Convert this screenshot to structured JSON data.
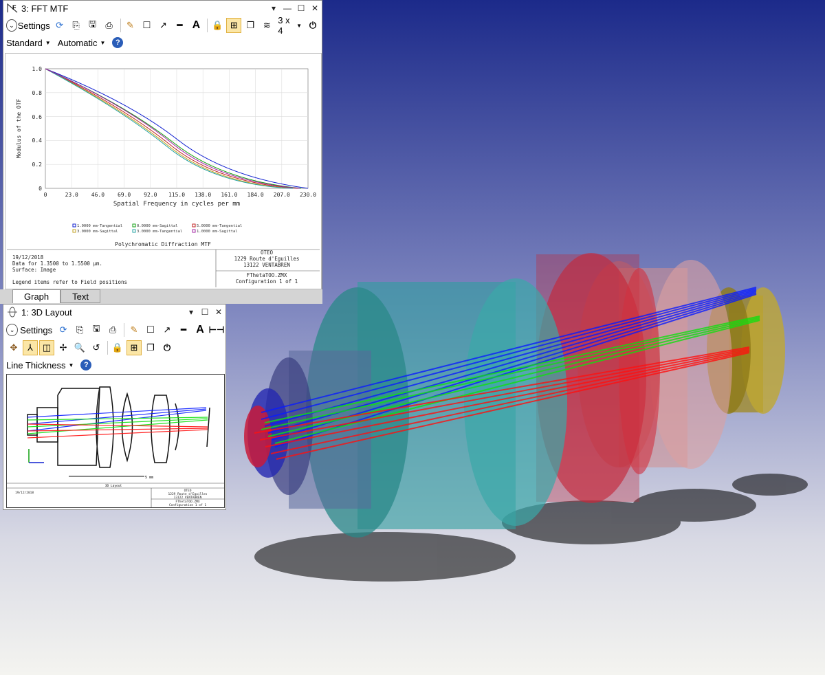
{
  "mtf_window": {
    "title": "3: FFT MTF",
    "settings_label": "Settings",
    "grid_label": "3 x 4",
    "dropdown1": "Standard",
    "dropdown2": "Automatic",
    "tabs": [
      "Graph",
      "Text"
    ],
    "plot": {
      "ylabel": "Modulus of the OTF",
      "xlabel": "Spatial Frequency in cycles per mm",
      "xticks": [
        "0",
        "23.0",
        "46.0",
        "69.0",
        "92.0",
        "115.0",
        "138.0",
        "161.0",
        "184.0",
        "207.0",
        "230.0"
      ],
      "yticks": [
        "0",
        "0.2",
        "0.4",
        "0.6",
        "0.8",
        "1.0"
      ],
      "legend": [
        "1.0000 mm-Tangential",
        "0.0000 mm-Sagittal",
        "5.0000 mm-Tangential",
        "3.0000 mm-Sagittal",
        "3.0000 mm-Tangential",
        "1.0000 mm-Sagittal"
      ],
      "caption": "Polychromatic Diffraction MTF",
      "info_left": [
        "19/12/2018",
        "Data for 1.3500 to 1.5500 µm.",
        "Surface: Image",
        "",
        "Legend items refer to Field positions"
      ],
      "info_right_top": [
        "OTEO",
        "1229 Route d'Eguilles",
        "13122 VENTABREN"
      ],
      "info_right_bottom": [
        "FThetaTOO.ZMX",
        "Configuration 1 of 1"
      ]
    }
  },
  "layout_window": {
    "title": "1: 3D Layout",
    "settings_label": "Settings",
    "dropdown": "Line Thickness",
    "scale_label": "3D Layout",
    "scale_value": "5 mm",
    "info_left": "19/12/2018",
    "info_right_top": [
      "OTEO",
      "1229 Route d'Eguilles",
      "13122 VENTABREN"
    ],
    "info_right_bottom": [
      "FThetaTOO.ZMX",
      "Configuration 1 of 1"
    ]
  },
  "colors": {
    "background_top": "#1c2a8a",
    "background_bottom": "#f4f4f0",
    "ray_blue": "#0a1cff",
    "ray_green": "#10e010",
    "ray_red": "#ff1010"
  }
}
